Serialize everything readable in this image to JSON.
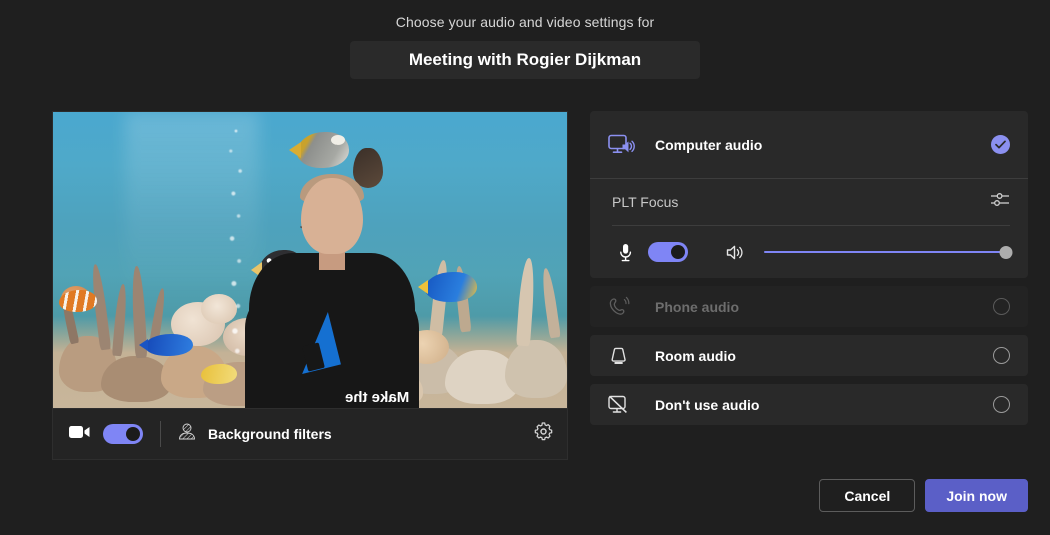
{
  "header": {
    "subtitle": "Choose your audio and video settings for",
    "meeting_title": "Meeting with Rogier Dijkman"
  },
  "video": {
    "camera_toggle_state": "on",
    "camera_icon": "camera-icon",
    "background_filters_icon": "background-blur-icon",
    "background_filters_label": "Background filters",
    "settings_icon": "gear-icon",
    "preview_alt": "Self video preview with aquarium virtual background",
    "shirt_text": "Make\nthe"
  },
  "audio": {
    "options": [
      {
        "id": "computer-audio",
        "label": "Computer audio",
        "icon": "monitor-speaker-icon",
        "selected": true,
        "disabled": false,
        "indicator": "checkmark"
      },
      {
        "id": "phone-audio",
        "label": "Phone audio",
        "icon": "phone-ringing-icon",
        "selected": false,
        "disabled": true,
        "indicator": "radio"
      },
      {
        "id": "room-audio",
        "label": "Room audio",
        "icon": "room-device-icon",
        "selected": false,
        "disabled": false,
        "indicator": "radio"
      },
      {
        "id": "dont-use-audio",
        "label": "Don't use audio",
        "icon": "monitor-muted-icon",
        "selected": false,
        "disabled": false,
        "indicator": "radio"
      }
    ],
    "device": {
      "name": "PLT Focus",
      "settings_icon": "audio-settings-sliders-icon",
      "mic_icon": "microphone-icon",
      "mic_toggle_state": "on",
      "speaker_icon": "speaker-volume-icon",
      "volume_percent": 100
    }
  },
  "footer": {
    "cancel_label": "Cancel",
    "join_label": "Join now"
  },
  "colors": {
    "page_background": "#1f1f1f",
    "panel_background": "#292929",
    "accent": "#5b5fc7",
    "accent_light": "#7f85f5",
    "text_primary": "#ffffff",
    "text_secondary": "#c8c8c8",
    "text_disabled": "#6d6d6d"
  }
}
